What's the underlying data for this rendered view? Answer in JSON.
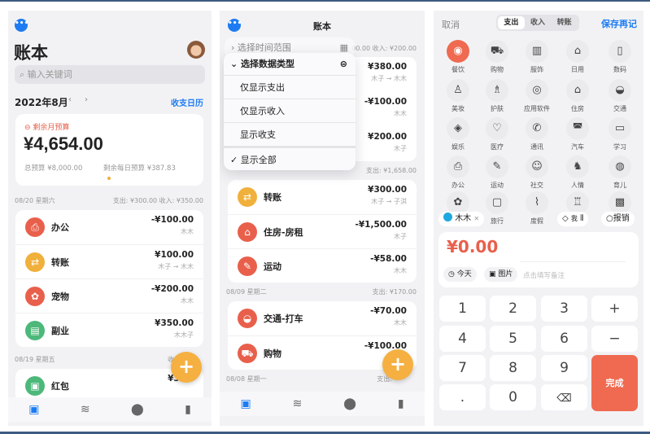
{
  "colors": {
    "accent": "#1d7cf2",
    "expense": "#e8604c",
    "fab": "#f5b041",
    "income": "#4cb87a"
  },
  "p1": {
    "title": "账本",
    "search_placeholder": "输入关键词",
    "month": "2022年8月",
    "calendar_link": "收支日历",
    "budget": {
      "label": "剩余月预算",
      "amount": "¥4,654.00",
      "total": "总预算 ¥8,000.00",
      "daily": "剩余每日预算 ¥387.83"
    },
    "day1": {
      "date": "08/20 星期六",
      "summary": "支出: ¥300.00 收入: ¥350.00"
    },
    "rows": [
      {
        "icon": "printer-icon",
        "glyph": "⎙",
        "color": "#e8604c",
        "name": "办公",
        "amount": "-¥100.00",
        "sub": "木木"
      },
      {
        "icon": "transfer-icon",
        "glyph": "⇄",
        "color": "#f0b03c",
        "name": "转账",
        "amount": "¥100.00",
        "sub": "木子 → 木木"
      },
      {
        "icon": "paw-icon",
        "glyph": "✿",
        "color": "#e8604c",
        "name": "宠物",
        "amount": "-¥200.00",
        "sub": "木木"
      },
      {
        "icon": "side-job-icon",
        "glyph": "▤",
        "color": "#4cb87a",
        "name": "副业",
        "amount": "¥350.00",
        "sub": "木木子"
      }
    ],
    "day2": {
      "date": "08/19 星期五",
      "summary": "收入"
    },
    "row5": {
      "icon": "red-packet-icon",
      "glyph": "▣",
      "color": "#4cb87a",
      "name": "红包",
      "amount": "¥30",
      "sub": "木木"
    }
  },
  "p2": {
    "title": "账本",
    "menu": {
      "time_range": "选择时间范围",
      "data_type": "选择数据类型",
      "items": [
        "仅显示支出",
        "仅显示收入",
        "显示收支",
        "显示全部"
      ]
    },
    "hidden_header": "00.00 收入: ¥200.00",
    "hidden_rows": [
      {
        "amount": "¥380.00",
        "sub": "木子 → 木木"
      },
      {
        "amount": "-¥100.00",
        "sub": "木木"
      },
      {
        "amount": "¥200.00",
        "sub": "木子"
      }
    ],
    "day1_summary": "支出: ¥1,658.00",
    "rows1": [
      {
        "glyph": "⇄",
        "color": "#f0b03c",
        "name": "转账",
        "amount": "¥300.00",
        "sub": "木子 → 子淇"
      },
      {
        "glyph": "⌂",
        "color": "#e8604c",
        "name": "住房-房租",
        "amount": "-¥1,500.00",
        "sub": "木子"
      },
      {
        "glyph": "✎",
        "color": "#e8604c",
        "name": "运动",
        "amount": "-¥58.00",
        "sub": "木木"
      }
    ],
    "day2": {
      "date": "08/09 星期二",
      "summary": "支出: ¥170.00"
    },
    "rows2": [
      {
        "glyph": "◒",
        "color": "#e8604c",
        "name": "交通-打车",
        "amount": "-¥70.00",
        "sub": "木木"
      },
      {
        "glyph": "⛟",
        "color": "#e8604c",
        "name": "购物",
        "amount": "-¥100.00",
        "sub": ""
      }
    ],
    "day3": {
      "date": "08/08 星期一",
      "summary": "支出:"
    }
  },
  "p3": {
    "cancel": "取消",
    "tabs": [
      "支出",
      "收入",
      "转账"
    ],
    "save_again": "保存再记",
    "categories": [
      "餐饮",
      "购物",
      "服饰",
      "日用",
      "数码",
      "美妆",
      "护肤",
      "应用软件",
      "住房",
      "交通",
      "娱乐",
      "医疗",
      "通讯",
      "汽车",
      "学习",
      "办公",
      "运动",
      "社交",
      "人情",
      "育儿",
      "",
      "旅行",
      "度假",
      "",
      ""
    ],
    "glyphs": [
      "◉",
      "⛟",
      "▥",
      "⌂",
      "▯",
      "♙",
      "♗",
      "◎",
      "⌂",
      "◒",
      "◈",
      "♡",
      "✆",
      "◚",
      "▭",
      "⎙",
      "✎",
      "☺",
      "♞",
      "◍",
      "✿",
      "▢",
      "⌇",
      "♖",
      "▩"
    ],
    "member": "木木",
    "tag": "我",
    "reimburse": "报销",
    "amount": "¥0.00",
    "today": "今天",
    "image": "图片",
    "note_placeholder": "点击填写备注",
    "keys": [
      "1",
      "2",
      "3",
      "+",
      "4",
      "5",
      "6",
      "−",
      "7",
      "8",
      "9",
      ".",
      "0"
    ],
    "done": "完成"
  }
}
